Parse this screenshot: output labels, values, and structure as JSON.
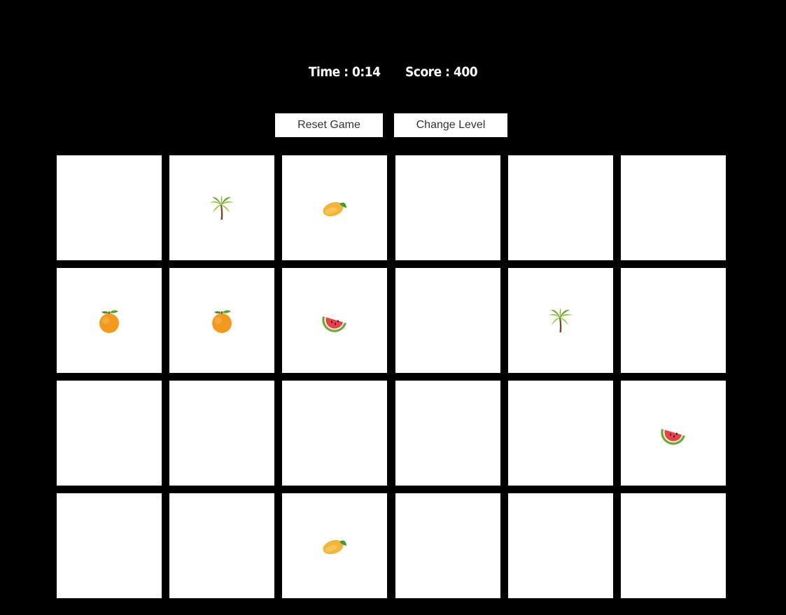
{
  "header": {
    "time_label": "Time :",
    "time_value": "0:14",
    "score_label": "Score :",
    "score_value": "400"
  },
  "controls": {
    "reset_label": "Reset Game",
    "change_level_label": "Change Level"
  },
  "board": {
    "rows": 4,
    "cols": 6,
    "cards": [
      "",
      "palm-tree",
      "mango",
      "",
      "",
      "",
      "tangerine",
      "tangerine",
      "watermelon",
      "",
      "palm-tree",
      "",
      "",
      "",
      "",
      "",
      "",
      "watermelon",
      "",
      "",
      "mango",
      "",
      "",
      ""
    ]
  },
  "colors": {
    "background": "#000000",
    "card": "#ffffff",
    "text": "#ffffff"
  }
}
